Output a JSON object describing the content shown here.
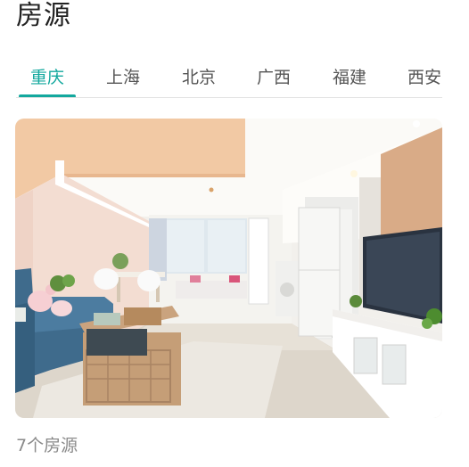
{
  "page": {
    "title": "房源"
  },
  "tabs": [
    {
      "label": "重庆",
      "active": true
    },
    {
      "label": "上海",
      "active": false
    },
    {
      "label": "北京",
      "active": false
    },
    {
      "label": "广西",
      "active": false
    },
    {
      "label": "福建",
      "active": false
    },
    {
      "label": "西安",
      "active": false
    }
  ],
  "listing": {
    "count_label": "7个房源",
    "photo": "apartment-interior-photo"
  },
  "colors": {
    "accent": "#13a89e",
    "text_primary": "#222222",
    "text_secondary": "#8a8a8a"
  }
}
